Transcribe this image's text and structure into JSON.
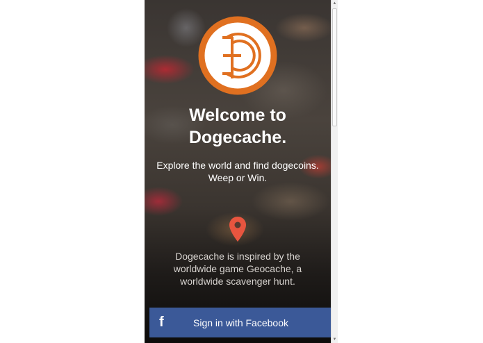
{
  "app": {
    "title_line1": "Welcome to",
    "title_line2": "Dogecache.",
    "tagline_line1": "Explore the world and find dogecoins.",
    "tagline_line2": "Weep or Win.",
    "description_line1": "Dogecache is inspired by the",
    "description_line2": "worldwide game Geocache, a",
    "description_line3": "worldwide scavenger hunt."
  },
  "login": {
    "facebook_label": "Sign in with Facebook",
    "facebook_icon": "f"
  },
  "icons": {
    "logo": "dogecoin-logo-icon",
    "location": "map-pin-icon",
    "facebook": "facebook-icon"
  },
  "colors": {
    "logo_orange": "#e07020",
    "pin_red": "#e8553f",
    "facebook_blue": "#3b5998"
  }
}
